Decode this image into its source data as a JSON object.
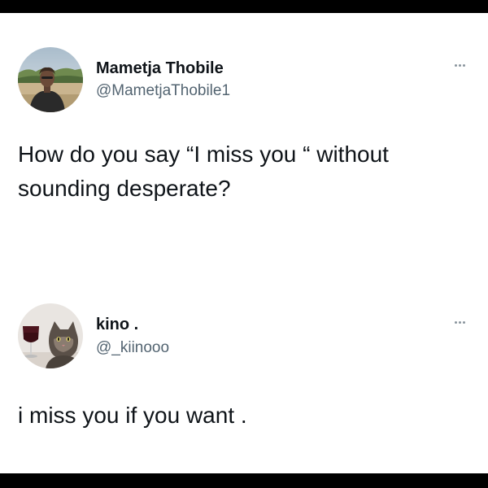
{
  "tweets": [
    {
      "author": {
        "display_name": "Mametja Thobile",
        "handle": "@MametjaThobile1",
        "avatar_icon": "person-outdoors-avatar"
      },
      "text": "How do you say “I miss you “ without sounding desperate?",
      "more_icon": "more-options-icon"
    },
    {
      "author": {
        "display_name": "kino .",
        "handle": "@_kiinooo",
        "avatar_icon": "cat-with-wine-glass-avatar"
      },
      "text": "i miss you if you want .",
      "more_icon": "more-options-icon"
    }
  ],
  "colors": {
    "background_border": "#000000",
    "card_background": "#ffffff",
    "name_text": "#0f1419",
    "handle_text": "#536471",
    "more_dots": "#8a959e"
  }
}
